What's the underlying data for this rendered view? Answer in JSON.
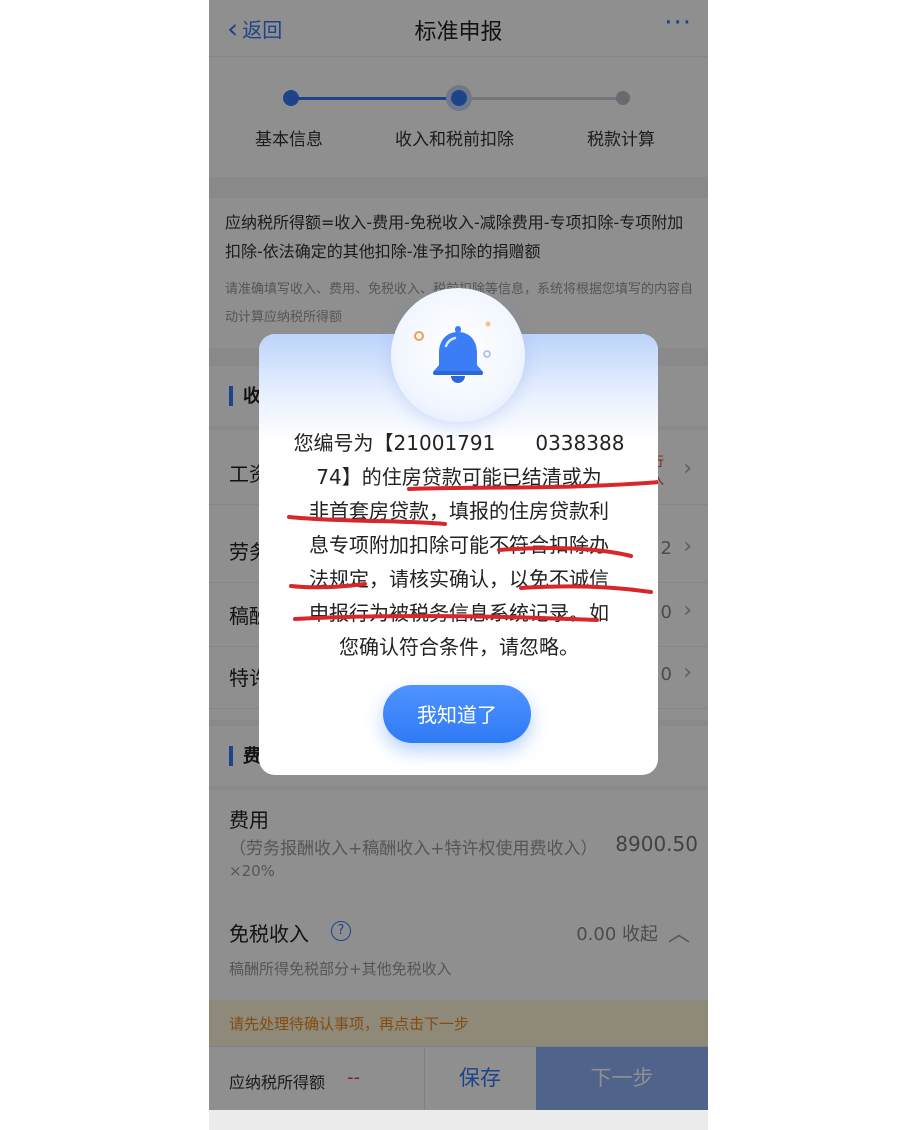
{
  "header": {
    "back_label": "返回",
    "title": "标准申报",
    "more_label": "···"
  },
  "steps": [
    {
      "label": "基本信息",
      "state": "done"
    },
    {
      "label": "收入和税前扣除",
      "state": "current"
    },
    {
      "label": "税款计算",
      "state": "pending"
    }
  ],
  "formula": {
    "main": "应纳税所得额=收入-费用-免税收入-减除费用-专项扣除-专项附加扣除-依法确定的其他扣除-准予扣除的捐赠额",
    "hint": "请准确填写收入、费用、免税收入、税前扣除等信息，系统将根据您填写的内容自动计算应纳税所得额"
  },
  "sections": {
    "income_title": "收",
    "fee_title": "费"
  },
  "income_rows": [
    {
      "label": "工资",
      "value": "",
      "alert": "行\n入"
    },
    {
      "label": "劳务",
      "value": "2"
    },
    {
      "label": "稿酬",
      "value": "0"
    },
    {
      "label": "特许",
      "value": "0"
    }
  ],
  "fees": {
    "label": "费用",
    "formula": "（劳务报酬收入+稿酬收入+特许权使用费收入）",
    "value": "8900.50",
    "rate": "×20%",
    "exempt_label": "免税收入",
    "exempt_value": "0.00 收起",
    "exempt_desc": "稿酬所得免税部分+其他免税收入"
  },
  "warning": "请先处理待确认事项，再点击下一步",
  "bottom": {
    "tax_label": "应纳税所得额",
    "tax_value": "--",
    "save_label": "保存",
    "next_label": "下一步"
  },
  "dialog": {
    "lines": [
      "您编号为【21001791　　0338388",
      "74】的住房贷款可能已结清或为",
      "非首套房贷款，填报的住房贷款利",
      "息专项附加扣除可能不符合扣除办",
      "法规定，请核实确认，以免不诚信",
      "申报行为被税务信息系统记录。如",
      "您确认符合条件，请忽略。"
    ],
    "button_label": "我知道了"
  },
  "colors": {
    "primary": "#3478f6",
    "warning_bg": "#fff4d9",
    "warning_text": "#e8891f",
    "underline": "#d8262a"
  }
}
